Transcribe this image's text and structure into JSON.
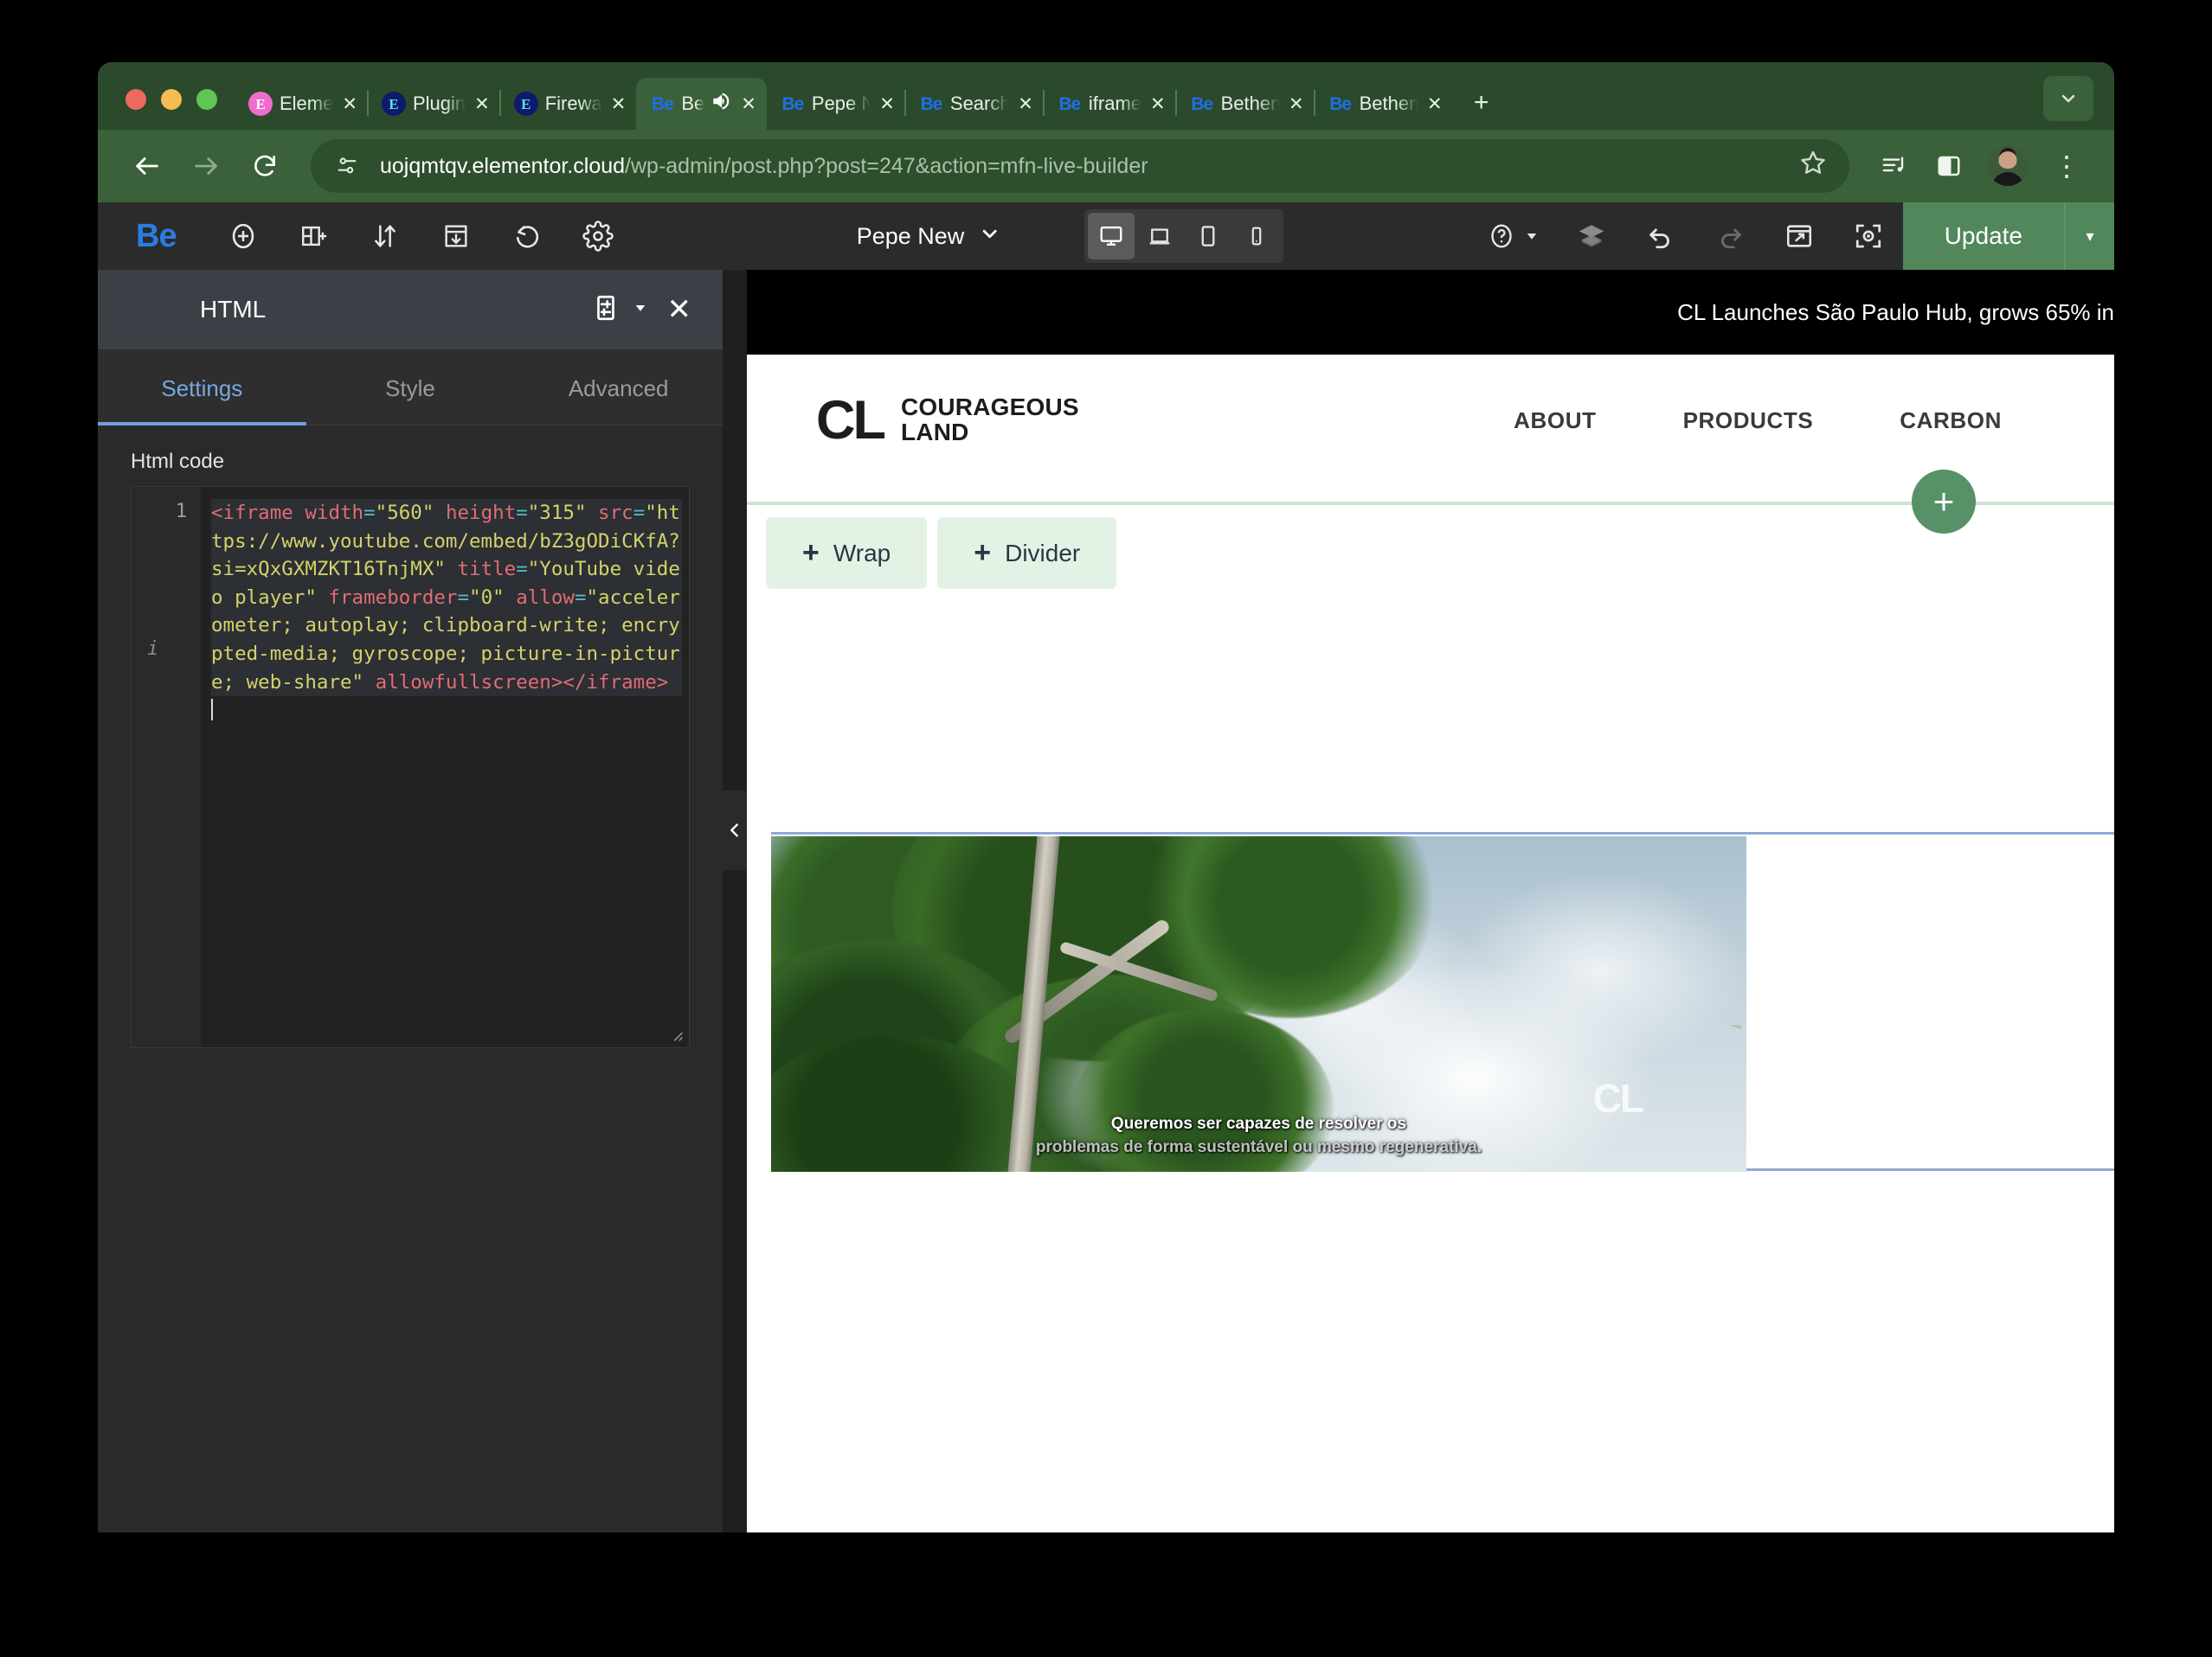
{
  "browser": {
    "tabs": [
      {
        "favicon": "elementor-icon",
        "favicon_style": "pink",
        "title": "Eleme",
        "close": "✕",
        "active": false
      },
      {
        "favicon": "elementor-icon",
        "favicon_style": "blue",
        "title": "Plugin",
        "close": "✕",
        "active": false
      },
      {
        "favicon": "elementor-icon",
        "favicon_style": "blue",
        "title": "Firewa",
        "close": "✕",
        "active": false
      },
      {
        "favicon": "be-icon",
        "favicon_style": "be",
        "title": "Be",
        "audio": "speaker-icon",
        "close": "✕",
        "active": true
      },
      {
        "favicon": "be-icon",
        "favicon_style": "be",
        "title": "Pepe N",
        "close": "✕",
        "active": false
      },
      {
        "favicon": "be-icon",
        "favicon_style": "be",
        "title": "Search",
        "close": "✕",
        "active": false
      },
      {
        "favicon": "be-icon",
        "favicon_style": "be",
        "title": "iframe",
        "close": "✕",
        "active": false
      },
      {
        "favicon": "be-icon",
        "favicon_style": "be",
        "title": "Bethen",
        "close": "✕",
        "active": false
      },
      {
        "favicon": "be-icon",
        "favicon_style": "be",
        "title": "Bethen",
        "close": "✕",
        "active": false
      }
    ],
    "new_tab_label": "+",
    "tab_list_caret": "⌄",
    "omnibox": {
      "domain": "uojqmtqv.elementor.cloud",
      "path": "/wp-admin/post.php?post=247&action=mfn-live-builder"
    },
    "toolbar_icons": [
      "back-arrow-icon",
      "forward-arrow-icon",
      "reload-icon",
      "site-info-icon",
      "bookmark-star-icon",
      "reading-list-icon",
      "side-panel-icon",
      "profile-avatar",
      "chrome-menu-icon"
    ],
    "chrome_menu": "⋮"
  },
  "elementor": {
    "logo": "Be",
    "top_tools": [
      "add-element-icon",
      "add-template-icon",
      "sort-icon",
      "save-template-icon",
      "history-icon",
      "settings-gear-icon"
    ],
    "document_name": "Pepe New",
    "document_caret": "⌄",
    "devices": [
      {
        "name": "desktop-device",
        "active": true
      },
      {
        "name": "laptop-device",
        "active": false
      },
      {
        "name": "tablet-device",
        "active": false
      },
      {
        "name": "mobile-device",
        "active": false
      }
    ],
    "right_tools": [
      "help-icon",
      "help-caret",
      "layers-icon",
      "undo-icon",
      "redo-icon",
      "preview-changes-icon",
      "finder-icon"
    ],
    "update_label": "Update",
    "update_caret": "▾"
  },
  "panel": {
    "title": "HTML",
    "widget_icon": "widget-settings-icon",
    "caret": "▾",
    "close": "✕",
    "tabs": [
      {
        "label": "Settings",
        "active": true
      },
      {
        "label": "Style",
        "active": false
      },
      {
        "label": "Advanced",
        "active": false
      }
    ],
    "code_label": "Html code",
    "line_number": "1",
    "gutter_info": "i",
    "code": {
      "full": "<iframe width=\"560\" height=\"315\" src=\"https://www.youtube.com/embed/bZ3gODiCKfA?si=xQxGXMZKT16TnjMX\" title=\"YouTube video player\" frameborder=\"0\" allow=\"accelerometer; autoplay; clipboard-write; encrypted-media; gyroscope; picture-in-picture; web-share\" allowfullscreen></iframe>",
      "tokens": [
        {
          "t": "tag",
          "v": "<iframe "
        },
        {
          "t": "attr",
          "v": "width"
        },
        {
          "t": "eq",
          "v": "="
        },
        {
          "t": "str",
          "v": "\"560\""
        },
        {
          "t": "plain",
          "v": " "
        },
        {
          "t": "attr",
          "v": "height"
        },
        {
          "t": "eq",
          "v": "="
        },
        {
          "t": "str",
          "v": "\"315\""
        },
        {
          "t": "plain",
          "v": " "
        },
        {
          "t": "attr",
          "v": "src"
        },
        {
          "t": "eq",
          "v": "="
        },
        {
          "t": "str",
          "v": "\"https://www.youtube.com/embed/bZ3gODiCKfA?si=xQxGXMZKT16TnjMX\""
        },
        {
          "t": "plain",
          "v": " "
        },
        {
          "t": "attr",
          "v": "title"
        },
        {
          "t": "eq",
          "v": "="
        },
        {
          "t": "str",
          "v": "\"YouTube video player\""
        },
        {
          "t": "plain",
          "v": " "
        },
        {
          "t": "attr",
          "v": "frameborder"
        },
        {
          "t": "eq",
          "v": "="
        },
        {
          "t": "str",
          "v": "\"0\""
        },
        {
          "t": "plain",
          "v": " "
        },
        {
          "t": "attr",
          "v": "allow"
        },
        {
          "t": "eq",
          "v": "="
        },
        {
          "t": "str",
          "v": "\"accelerometer; autoplay; clipboard-write; encrypted-media; gyroscope; picture-in-picture; web-share\""
        },
        {
          "t": "plain",
          "v": " "
        },
        {
          "t": "attr",
          "v": "allowfullscreen"
        },
        {
          "t": "tag",
          "v": "></iframe>"
        }
      ]
    },
    "collapse_arrow": "‹"
  },
  "preview": {
    "announcement": "CL Launches São Paulo Hub, grows 65% in",
    "brand": {
      "mark": "CL",
      "line1": "COURAGEOUS",
      "line2": "LAND"
    },
    "nav": [
      "ABOUT",
      "PRODUCTS",
      "CARBON"
    ],
    "add_section_plus": "+",
    "chips": [
      {
        "plus": "+",
        "label": "Wrap"
      },
      {
        "plus": "+",
        "label": "Divider"
      }
    ],
    "video": {
      "watermark": "CL",
      "caption_line1": "Queremos ser capazes de resolver os",
      "caption_line2": "problemas de forma sustentável ou mesmo regenerativa."
    }
  },
  "colors": {
    "browser_chrome": "#3a6139",
    "elementor_blue": "#2a7de1",
    "update_green": "#51875b",
    "panel_tab_active": "#78a7e0",
    "chip_bg": "#e4f2e6"
  }
}
